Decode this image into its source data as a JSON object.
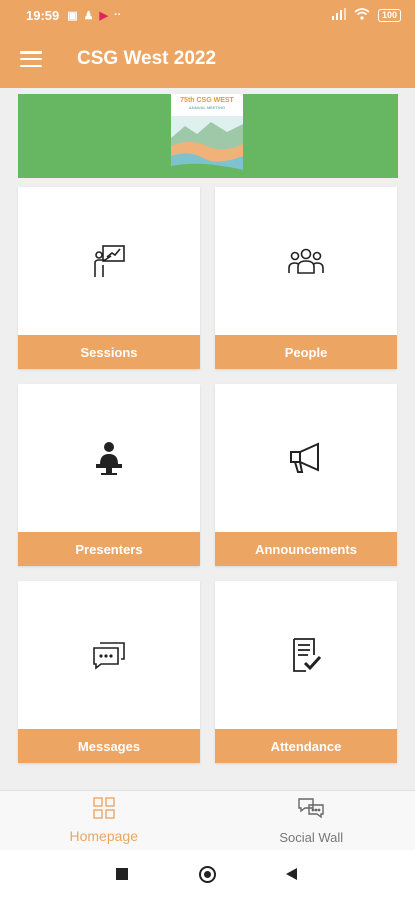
{
  "statusbar": {
    "time": "19:59",
    "battery": "100"
  },
  "appbar": {
    "title": "CSG West 2022"
  },
  "banner": {
    "line1": "75th CSG WEST",
    "line2": "ANNUAL MEETING"
  },
  "tiles": [
    {
      "label": "Sessions",
      "icon": "presentation-icon"
    },
    {
      "label": "People",
      "icon": "people-icon"
    },
    {
      "label": "Presenters",
      "icon": "presenter-icon"
    },
    {
      "label": "Announcements",
      "icon": "megaphone-icon"
    },
    {
      "label": "Messages",
      "icon": "messages-icon"
    },
    {
      "label": "Attendance",
      "icon": "attendance-icon"
    }
  ],
  "bottomnav": {
    "items": [
      {
        "label": "Homepage",
        "active": true
      },
      {
        "label": "Social Wall",
        "active": false
      }
    ]
  },
  "colors": {
    "accent": "#eda563",
    "banner_green": "#67b662",
    "background": "#efefef"
  }
}
